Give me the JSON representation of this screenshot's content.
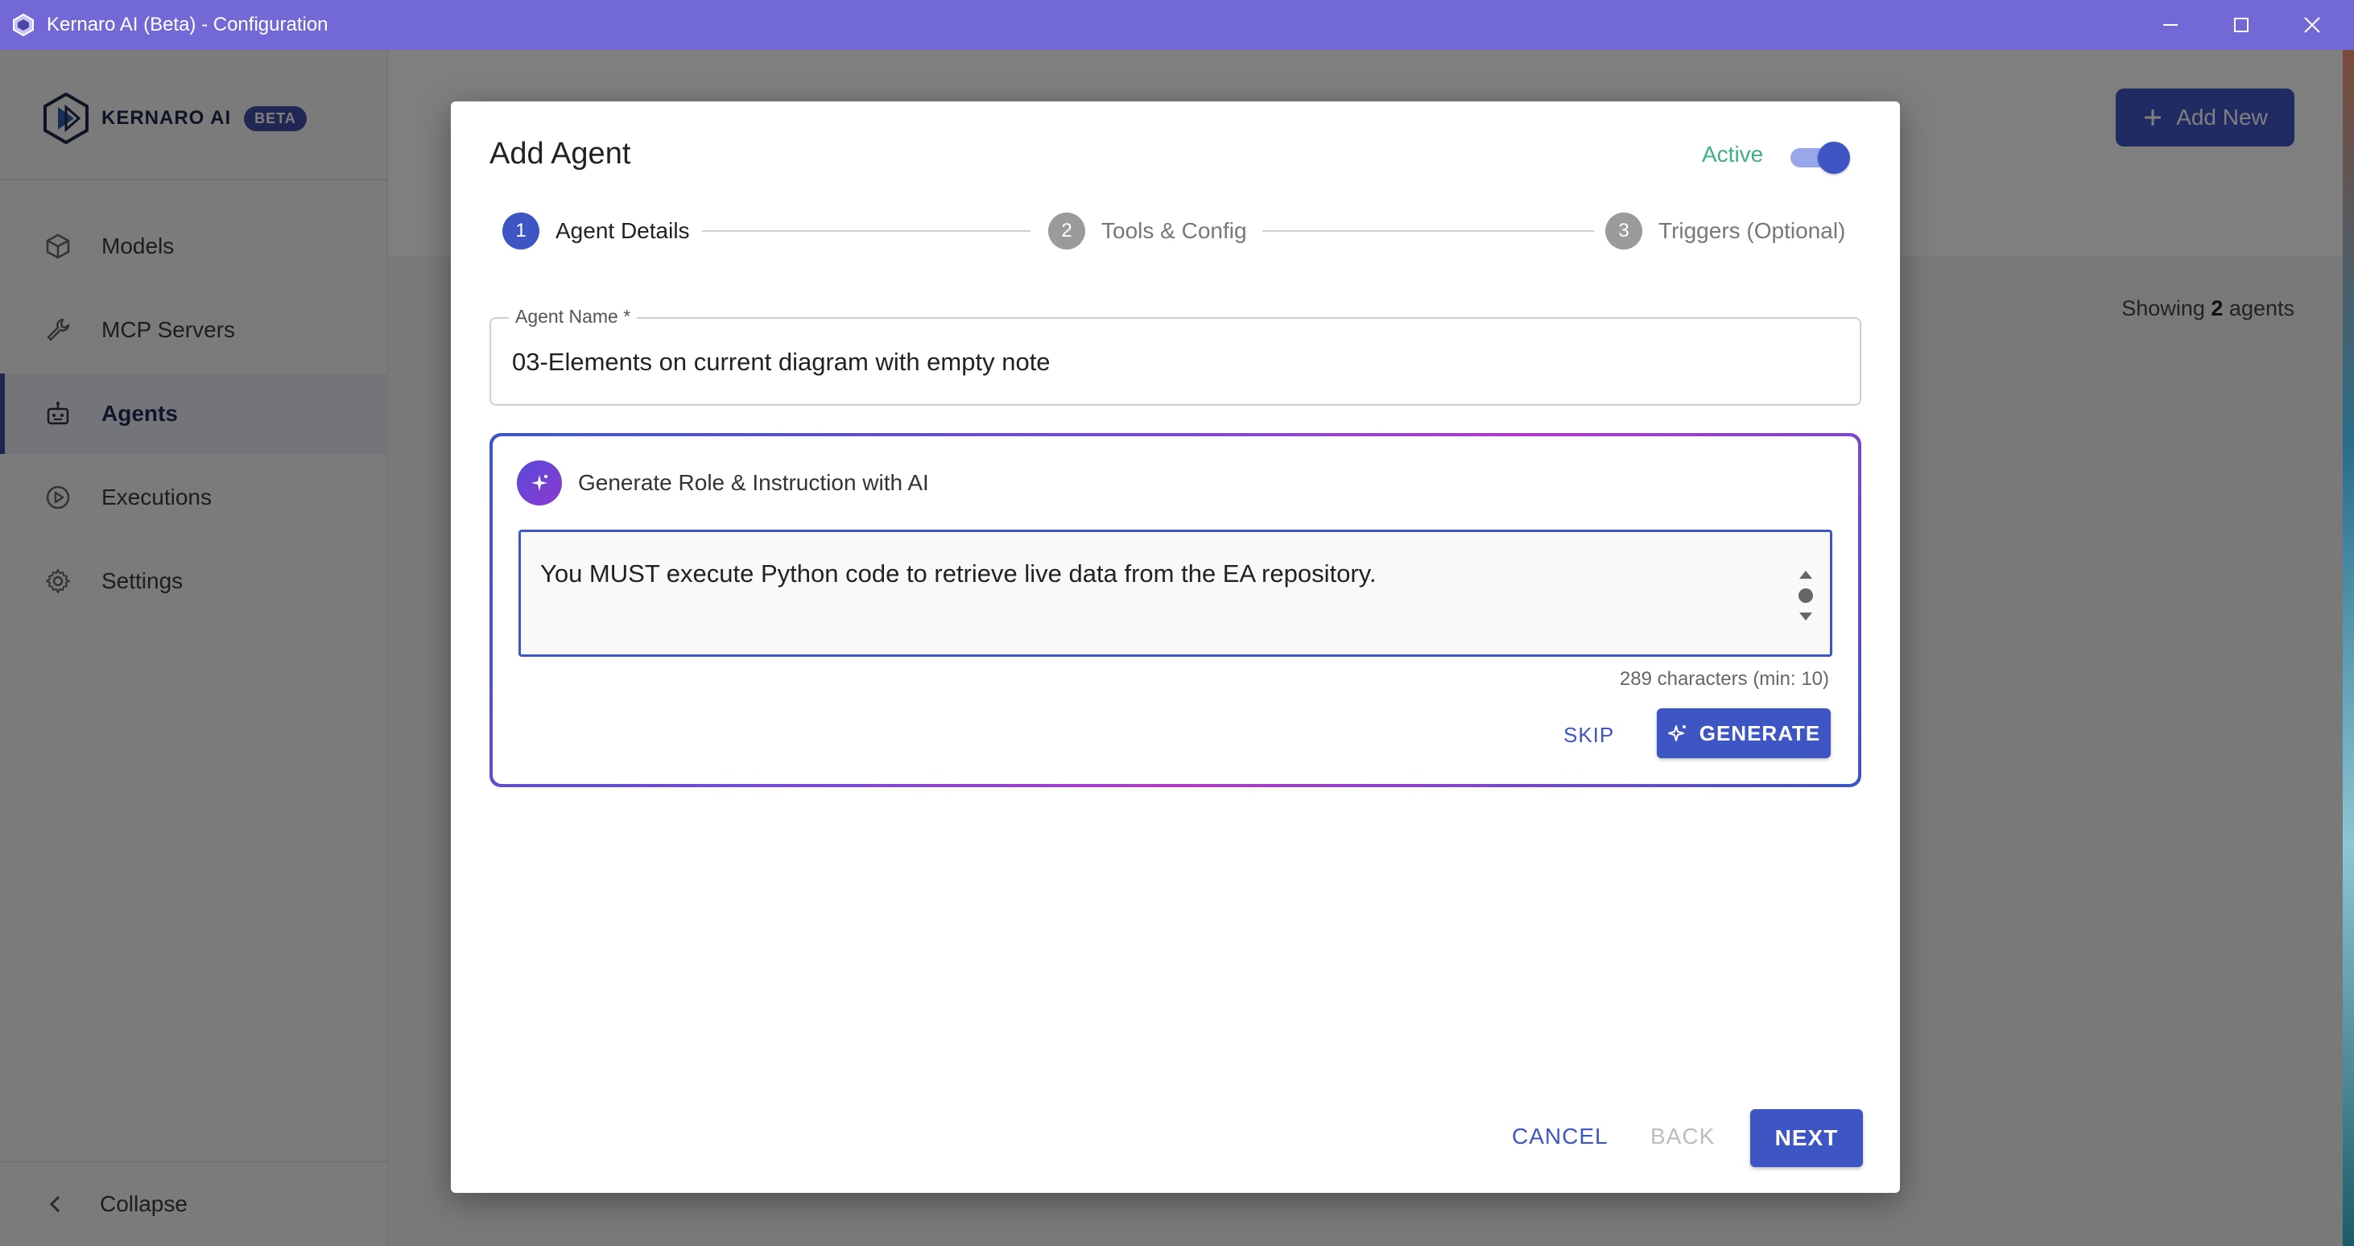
{
  "window": {
    "title": "Kernaro AI (Beta) - Configuration",
    "icons": [
      "app-logo-icon",
      "minimize-icon",
      "maximize-icon",
      "close-icon"
    ]
  },
  "sidebar": {
    "logo": {
      "text_main": "KERNARO",
      "text_ai": "AI",
      "badge": "BETA"
    },
    "items": [
      {
        "label": "Models",
        "icon": "cube-icon"
      },
      {
        "label": "MCP Servers",
        "icon": "wrench-icon"
      },
      {
        "label": "Agents",
        "icon": "robot-icon",
        "active": true
      },
      {
        "label": "Executions",
        "icon": "play-circle-icon"
      },
      {
        "label": "Settings",
        "icon": "gear-icon"
      }
    ],
    "collapse_label": "Collapse"
  },
  "main": {
    "add_new_label": "Add New",
    "showing_prefix": "Showing",
    "showing_count": "2",
    "showing_suffix": "agents"
  },
  "dialog": {
    "title": "Add Agent",
    "active_label": "Active",
    "active_on": true,
    "steps": [
      {
        "number": "1",
        "label": "Agent Details",
        "state": "active"
      },
      {
        "number": "2",
        "label": "Tools & Config",
        "state": "inactive"
      },
      {
        "number": "3",
        "label": "Triggers (Optional)",
        "state": "inactive"
      }
    ],
    "agent_name": {
      "label": "Agent Name *",
      "value": "03-Elements on current diagram with empty note"
    },
    "generate_section": {
      "title": "Generate Role & Instruction with AI",
      "prompt_text": "You MUST execute Python code to retrieve live data from the EA repository.",
      "counter": "289 characters (min: 10)",
      "skip_label": "SKIP",
      "generate_label": "GENERATE"
    },
    "footer": {
      "cancel_label": "CANCEL",
      "back_label": "BACK",
      "next_label": "NEXT"
    }
  },
  "colors": {
    "titlebar": "#7269d6",
    "primary": "#3e56c4",
    "active_green": "#3cb08a"
  }
}
